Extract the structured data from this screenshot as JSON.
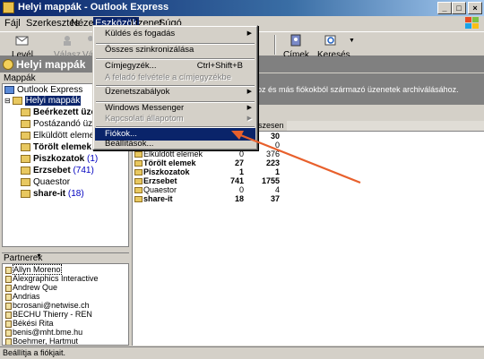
{
  "window": {
    "title": "Helyi mappák - Outlook Express"
  },
  "menubar": [
    "Fájl",
    "Szerkesztés",
    "Nézet",
    "Eszközök",
    "Üzenet",
    "Súgó"
  ],
  "toolbar": {
    "new_mail": "Levél lét...",
    "reply": "Válasz",
    "reply_all": "Vál",
    "contacts": "Címek",
    "find": "Keresés"
  },
  "band": {
    "title": "Helyi mappák"
  },
  "folder_pane": {
    "title": "Mappák",
    "items": [
      {
        "label": "Outlook Express",
        "count": ""
      },
      {
        "label": "Helyi mappák",
        "count": ""
      },
      {
        "label": "Beérkezett üzene",
        "count": ""
      },
      {
        "label": "Postázandó üzenete",
        "count": ""
      },
      {
        "label": "Elküldött elemek",
        "count": ""
      },
      {
        "label": "Törölt elemek",
        "count": "(27"
      },
      {
        "label": "Piszkozatok",
        "count": "(1)"
      },
      {
        "label": "Erzsebet",
        "count": "(741)"
      },
      {
        "label": "Quaestor",
        "count": ""
      },
      {
        "label": "share-it",
        "count": "(18)"
      }
    ]
  },
  "contacts_pane": {
    "title": "Partnerek",
    "items": [
      "Allyn Moreno",
      "Alexgraphics Interactive",
      "Andrew Que",
      "Andrias",
      "bcrosani@netwise.ch",
      "BECHU Thierry - REN",
      "Békési Rita",
      "benis@mht.bme.hu",
      "Boehmer, Hartmut"
    ]
  },
  "info": {
    "text": "oz és más fiókokból származó üzenetek archiválásához."
  },
  "table": {
    "header_total": "szesen",
    "rows": [
      {
        "name": "",
        "unread": "",
        "total": "30"
      },
      {
        "name": "",
        "unread": "",
        "total": "0"
      },
      {
        "name": "Elküldött elemek",
        "unread": "0",
        "total": "376"
      },
      {
        "name": "Törölt elemek",
        "unread": "27",
        "total": "223"
      },
      {
        "name": "Piszkozatok",
        "unread": "1",
        "total": "1"
      },
      {
        "name": "Erzsebet",
        "unread": "741",
        "total": "1755"
      },
      {
        "name": "Quaestor",
        "unread": "0",
        "total": "4"
      },
      {
        "name": "share-it",
        "unread": "18",
        "total": "37"
      }
    ]
  },
  "dropdown": {
    "items": [
      {
        "label": "Küldés és fogadás",
        "shortcut": ""
      },
      {
        "label": "Összes szinkronizálása",
        "shortcut": ""
      },
      {
        "label": "Címjegyzék...",
        "shortcut": "Ctrl+Shift+B"
      },
      {
        "label": "A feladó felvétele a címjegyzékbe",
        "shortcut": ""
      },
      {
        "label": "Üzenetszabályok",
        "shortcut": ""
      },
      {
        "label": "Windows Messenger",
        "shortcut": ""
      },
      {
        "label": "Kapcsolati állapotom",
        "shortcut": ""
      },
      {
        "label": "Fiókok...",
        "shortcut": ""
      },
      {
        "label": "Beállítások...",
        "shortcut": ""
      }
    ]
  },
  "status": {
    "text": "Beállítja a fiókjait."
  },
  "colors": {
    "highlight": "#0a246a",
    "arrow": "#e8602c",
    "count": "#0000c0"
  }
}
